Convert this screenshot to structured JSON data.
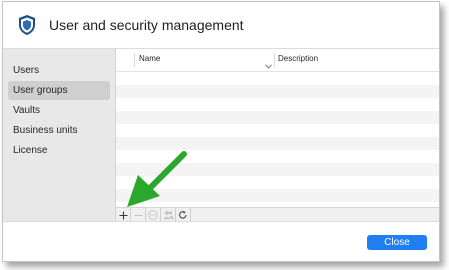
{
  "window": {
    "title": "User and security management",
    "app_icon": "shield-icon",
    "accent_color": "#1f7ff0"
  },
  "sidebar": {
    "items": [
      {
        "label": "Users",
        "selected": false
      },
      {
        "label": "User groups",
        "selected": true
      },
      {
        "label": "Vaults",
        "selected": false
      },
      {
        "label": "Business units",
        "selected": false
      },
      {
        "label": "License",
        "selected": false
      }
    ]
  },
  "table": {
    "columns": [
      {
        "label": "Name",
        "sort_icon": "chevron-down-icon"
      },
      {
        "label": "Description"
      }
    ],
    "rows": []
  },
  "toolbar": {
    "buttons": [
      {
        "name": "add",
        "icon": "plus-icon",
        "enabled": true
      },
      {
        "name": "remove",
        "icon": "minus-icon",
        "enabled": false
      },
      {
        "name": "more",
        "icon": "ellipsis-icon",
        "enabled": false
      },
      {
        "name": "members",
        "icon": "users-icon",
        "enabled": false
      },
      {
        "name": "refresh",
        "icon": "refresh-icon",
        "enabled": true
      }
    ]
  },
  "footer": {
    "close_label": "Close"
  },
  "annotation": {
    "arrow_color": "#2ba82b",
    "points_to": "add"
  }
}
